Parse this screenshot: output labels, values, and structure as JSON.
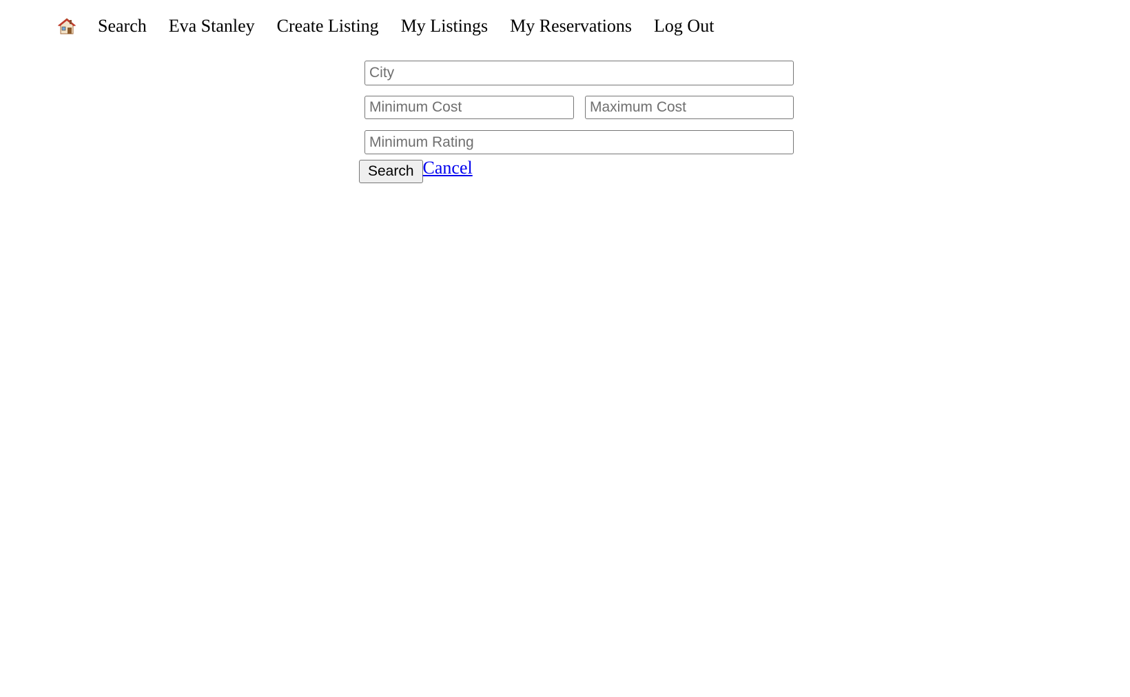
{
  "nav": {
    "home_icon": "house-icon",
    "items": [
      {
        "label": "Search"
      },
      {
        "label": "Eva Stanley"
      },
      {
        "label": "Create Listing"
      },
      {
        "label": "My Listings"
      },
      {
        "label": "My Reservations"
      },
      {
        "label": "Log Out"
      }
    ]
  },
  "search_form": {
    "city": {
      "placeholder": "City",
      "value": ""
    },
    "min_cost": {
      "placeholder": "Minimum Cost",
      "value": ""
    },
    "max_cost": {
      "placeholder": "Maximum Cost",
      "value": ""
    },
    "min_rating": {
      "placeholder": "Minimum Rating",
      "value": ""
    },
    "submit_label": "Search",
    "cancel_label": "Cancel"
  },
  "colors": {
    "link": "#0000ee",
    "button_bg": "#efefef",
    "border": "#767676"
  }
}
